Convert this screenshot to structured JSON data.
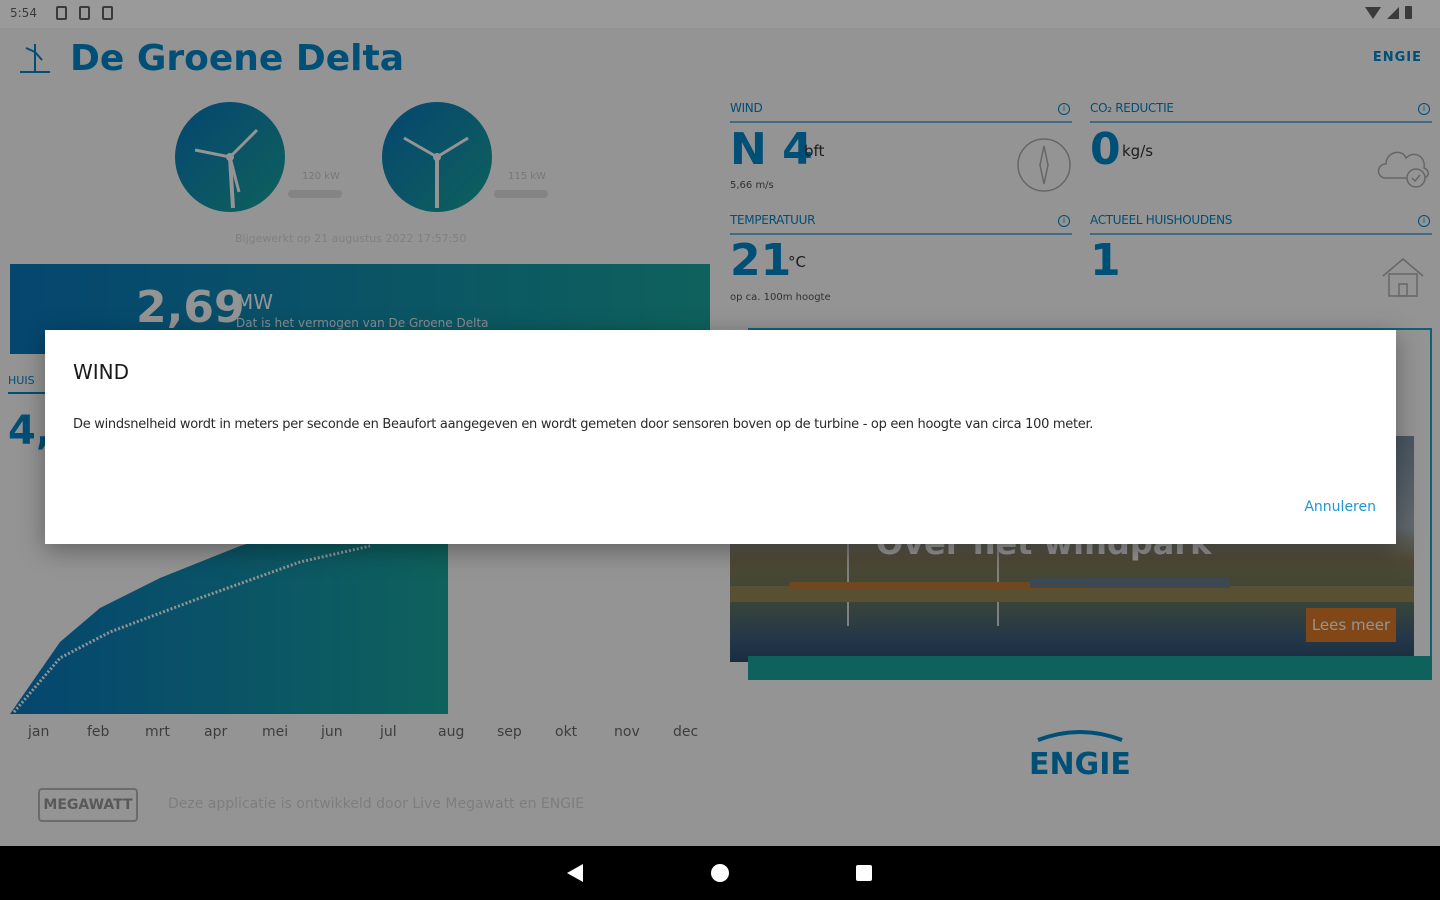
{
  "status_bar": {
    "time": "5:54"
  },
  "app": {
    "title": "De Groene Delta",
    "brand": "ENGIE",
    "turbines": [
      {
        "kw": "120 kW"
      },
      {
        "kw": "115 kW"
      }
    ],
    "updated": "Bijgewerkt op 21 augustus 2022 17:57:50",
    "production": {
      "value": "2,69",
      "unit": "MW",
      "subtitle": "Dat is het vermogen van De Groene Delta"
    },
    "households_label": "HUIS",
    "households_value": "4,",
    "cards": {
      "wind": {
        "label": "WIND",
        "value": "N 4",
        "unit": "bft",
        "sub": "5,66 m/s"
      },
      "co2": {
        "label": "CO₂ REDUCTIE",
        "value": "0",
        "unit": "kg/s"
      },
      "temperature": {
        "label": "TEMPERATUUR",
        "value": "21",
        "unit": "°C",
        "sub": "op ca. 100m hoogte"
      },
      "households": {
        "label": "ACTUEEL HUISHOUDENS",
        "value": "1"
      }
    },
    "about": {
      "title": "Over het windpark",
      "read_more": "Lees meer"
    },
    "footer": {
      "logo": "MEGAWATT",
      "text": "Deze applicatie is ontwikkeld door Live Megawatt en ENGIE"
    }
  },
  "chart_data": {
    "type": "area",
    "categories": [
      "jan",
      "feb",
      "mrt",
      "apr",
      "mei",
      "jun",
      "jul",
      "aug",
      "sep",
      "okt",
      "nov",
      "dec"
    ]
  },
  "dialog": {
    "title": "WIND",
    "body": "De windsnelheid wordt in meters per seconde en Beaufort aangegeven en wordt gemeten door sensoren boven op de turbine - op een hoogte van circa 100 meter.",
    "cancel": "Annuleren"
  },
  "colors": {
    "accent": "#0088cc",
    "teal": "#1aa8a0",
    "orange": "#e07b28"
  }
}
